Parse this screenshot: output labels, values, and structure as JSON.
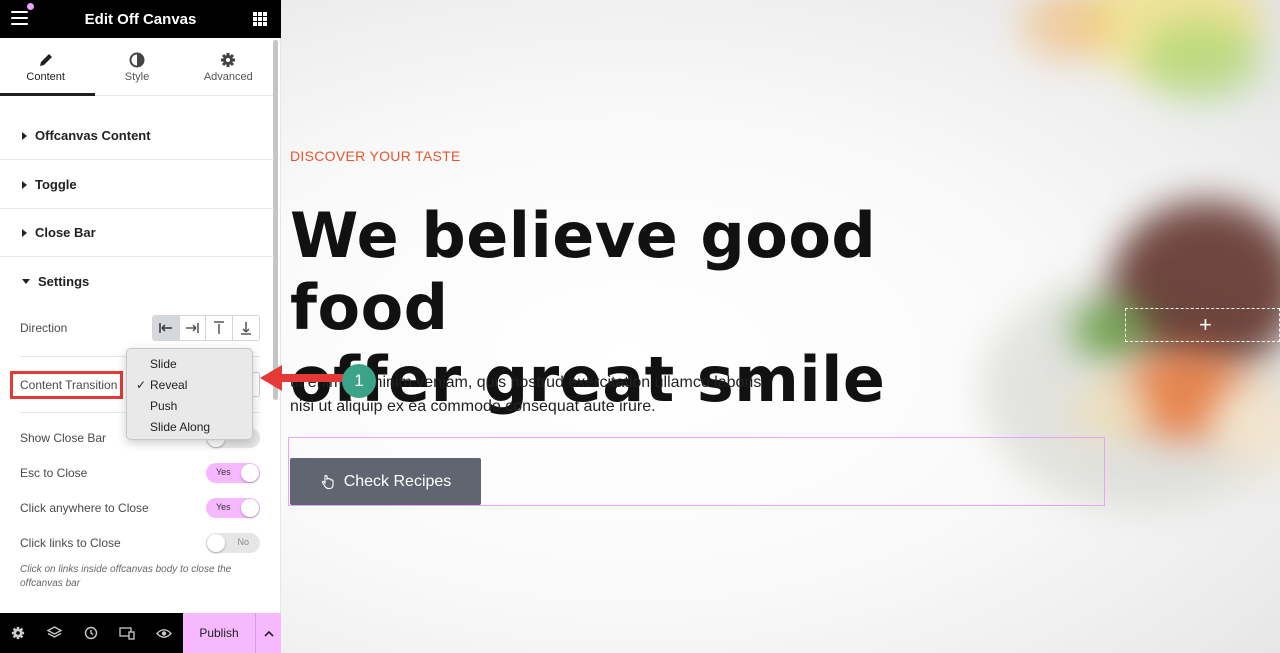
{
  "panel": {
    "title": "Edit Off Canvas",
    "tabs": [
      {
        "label": "Content",
        "icon": "pencil-icon"
      },
      {
        "label": "Style",
        "icon": "half-circle-icon"
      },
      {
        "label": "Advanced",
        "icon": "gear-icon"
      }
    ],
    "sections": [
      "Offcanvas Content",
      "Toggle",
      "Close Bar",
      "Settings"
    ],
    "direction_label": "Direction",
    "content_transition_label": "Content Transition",
    "dropdown_options": [
      "Slide",
      "Reveal",
      "Push",
      "Slide Along"
    ],
    "dropdown_selected": "Reveal",
    "show_close_bar_label": "Show Close Bar",
    "esc_label": "Esc to Close",
    "esc_value": "Yes",
    "click_anywhere_label": "Click anywhere to Close",
    "click_anywhere_value": "Yes",
    "click_links_label": "Click links to Close",
    "click_links_value": "No",
    "help_text": "Click on links inside offcanvas body to close the offcanvas bar",
    "publish_label": "Publish"
  },
  "preview": {
    "eyebrow": "DISCOVER YOUR TASTE",
    "headline_line1": "We believe good food",
    "headline_line2": "offer great smile",
    "body_line1": "ut enim ad minim veniam, quis nostrud exercitation ullamco laboris",
    "body_line2": "nisi ut aliquip ex ea commodo consequat aute irure.",
    "cta_label": "Check Recipes",
    "badge_number": "1"
  },
  "colors": {
    "accent_pink": "#f6b9ff",
    "eyebrow_orange": "#e4572e",
    "annotation_red": "#e53935",
    "badge_green": "#3ca486",
    "cta_gray": "#5f6670"
  }
}
